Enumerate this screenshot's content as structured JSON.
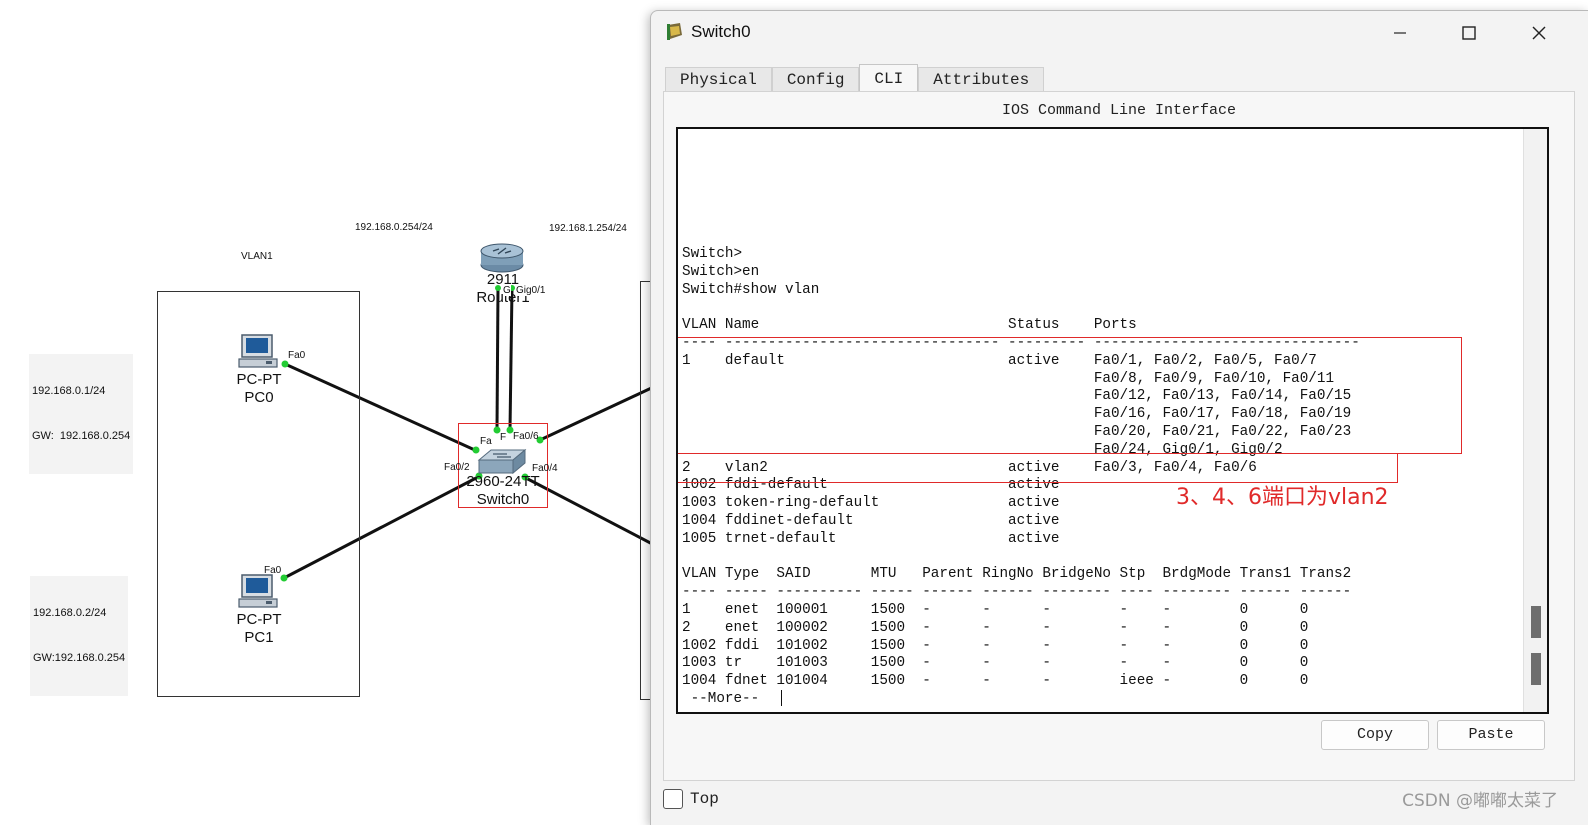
{
  "topology": {
    "labels": {
      "vlan1": "VLAN1",
      "router_ip_left": "192.168.0.254/24",
      "router_ip_right": "192.168.1.254/24",
      "pc0_ip": "192.168.0.1/24",
      "pc0_gw": "GW:  192.168.0.254",
      "pc1_ip": "192.168.0.2/24",
      "pc1_gw": "GW:192.168.0.254"
    },
    "devices": {
      "pc0": {
        "type": "PC-PT",
        "name": "PC0",
        "port": "Fa0"
      },
      "pc1": {
        "type": "PC-PT",
        "name": "PC1",
        "port": "Fa0"
      },
      "router": {
        "model": "2911",
        "name": "Router1",
        "port_g": "G",
        "port_gig": "Gig0/1"
      },
      "switch": {
        "model": "2960-24TT",
        "name": "Switch0",
        "port_fa": "Fa",
        "port_f": "F",
        "port_fa06": "Fa0/6",
        "port_fa02": "Fa0/2",
        "port_fa04": "Fa0/4"
      }
    }
  },
  "window": {
    "title": "Switch0",
    "tabs": [
      "Physical",
      "Config",
      "CLI",
      "Attributes"
    ],
    "active_tab": "CLI",
    "panel_title": "IOS Command Line Interface",
    "cli_lines": [
      "Switch>",
      "Switch>en",
      "Switch#show vlan",
      "",
      "VLAN Name                             Status    Ports",
      "---- -------------------------------- --------- -------------------------------",
      "1    default                          active    Fa0/1, Fa0/2, Fa0/5, Fa0/7",
      "                                                Fa0/8, Fa0/9, Fa0/10, Fa0/11",
      "                                                Fa0/12, Fa0/13, Fa0/14, Fa0/15",
      "                                                Fa0/16, Fa0/17, Fa0/18, Fa0/19",
      "                                                Fa0/20, Fa0/21, Fa0/22, Fa0/23",
      "                                                Fa0/24, Gig0/1, Gig0/2",
      "2    vlan2                            active    Fa0/3, Fa0/4, Fa0/6",
      "1002 fddi-default                     active",
      "1003 token-ring-default               active",
      "1004 fddinet-default                  active",
      "1005 trnet-default                    active",
      "",
      "VLAN Type  SAID       MTU   Parent RingNo BridgeNo Stp  BrdgMode Trans1 Trans2",
      "---- ----- ---------- ----- ------ ------ -------- ---- -------- ------ ------",
      "1    enet  100001     1500  -      -      -        -    -        0      0",
      "2    enet  100002     1500  -      -      -        -    -        0      0",
      "1002 fddi  101002     1500  -      -      -        -    -        0      0",
      "1003 tr    101003     1500  -      -      -        -    -        0      0",
      "1004 fdnet 101004     1500  -      -      -        ieee -        0      0",
      " --More-- "
    ],
    "annotation": "3、4、6端口为vlan2",
    "buttons": {
      "copy": "Copy",
      "paste": "Paste"
    },
    "top_checkbox_label": "Top",
    "top_checked": false
  },
  "watermark": "CSDN @嘟嘟太菜了",
  "colors": {
    "highlight": "#e02a2a",
    "link": "#111111",
    "port_dot": "#22cc33"
  }
}
